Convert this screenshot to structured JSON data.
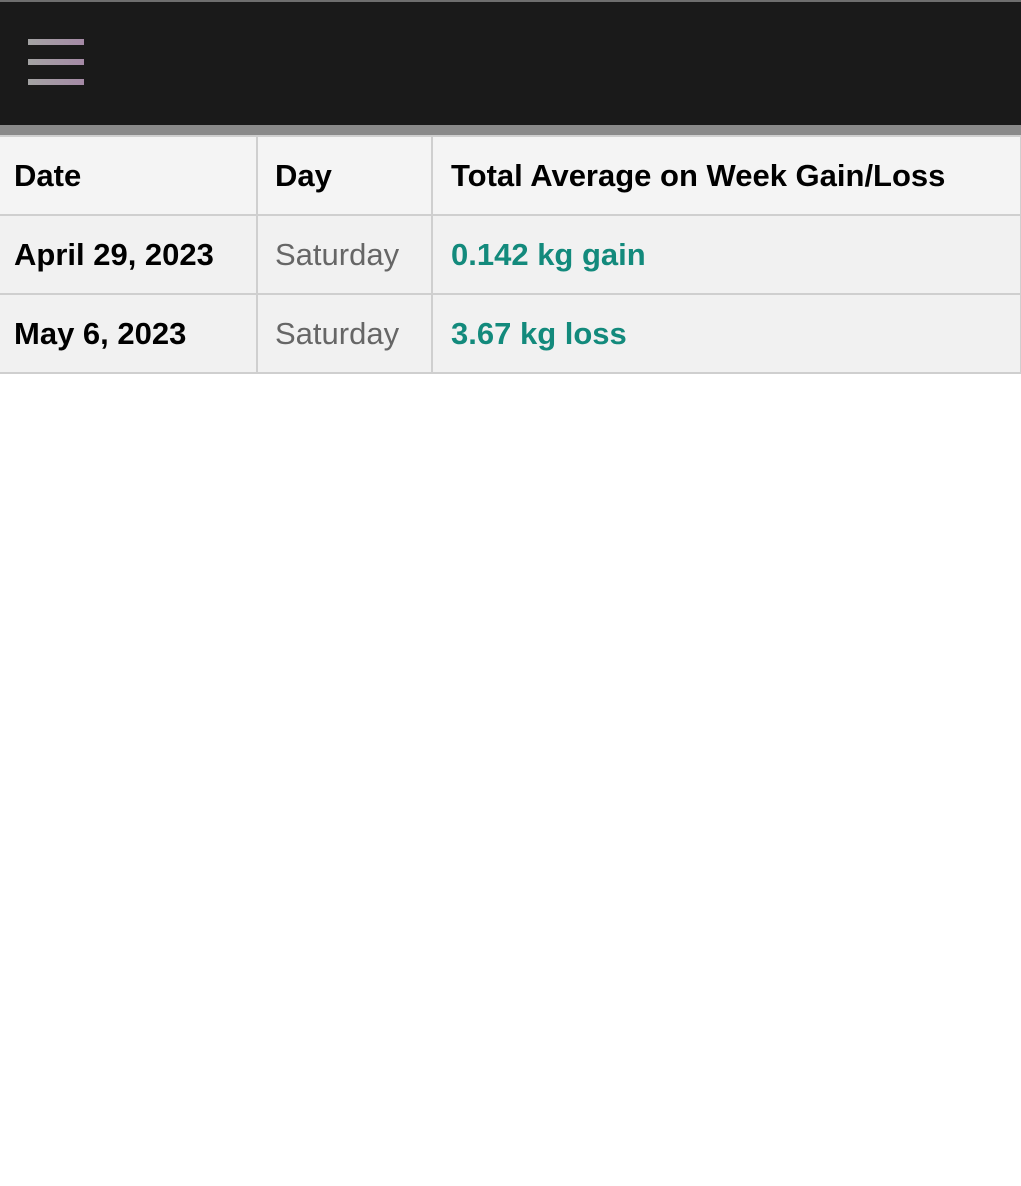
{
  "header": {
    "menu_icon": "hamburger-menu-icon"
  },
  "table": {
    "columns": [
      "Date",
      "Day",
      "Total Average on Week Gain/Loss"
    ],
    "rows": [
      {
        "date": "April 29, 2023",
        "day": "Saturday",
        "change": "0.142 kg gain"
      },
      {
        "date": "May 6, 2023",
        "day": "Saturday",
        "change": "3.67 kg loss"
      }
    ]
  },
  "colors": {
    "header_background": "#1a1a1a",
    "change_text": "#138a7c",
    "day_text": "#666666"
  }
}
